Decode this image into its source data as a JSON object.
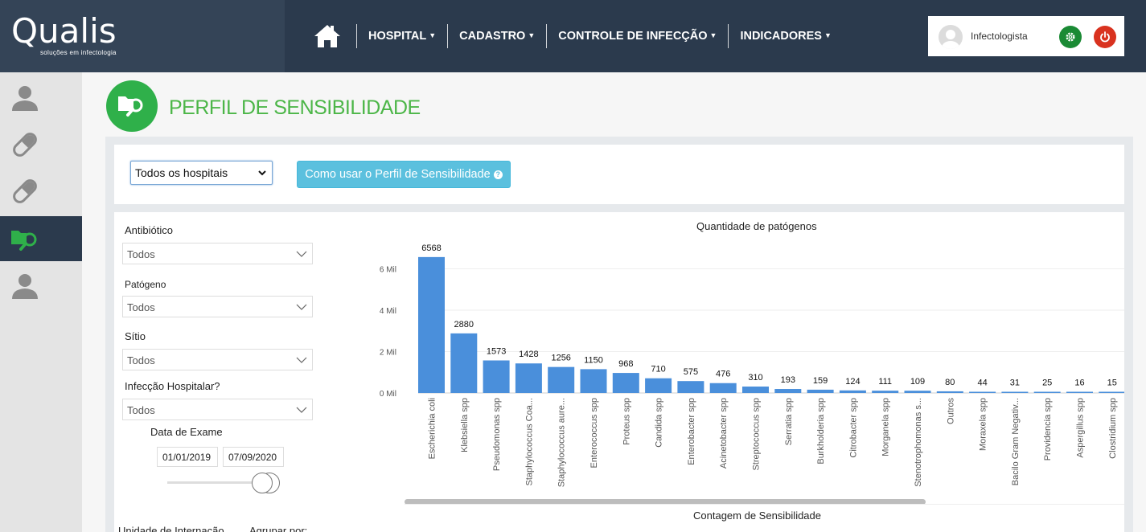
{
  "brand": {
    "name": "Qualis",
    "tagline": "soluções em infectologia"
  },
  "nav": {
    "items": [
      {
        "label": "HOSPITAL"
      },
      {
        "label": "CADASTRO"
      },
      {
        "label": "CONTROLE DE INFECÇÃO"
      },
      {
        "label": "INDICADORES"
      }
    ]
  },
  "user": {
    "name": "Infectologista"
  },
  "page": {
    "title": "PERFIL DE SENSIBILIDADE"
  },
  "toolbar": {
    "hospital_select": "Todos os hospitais",
    "help_button": "Como usar o Perfil de Sensibilidade"
  },
  "filters": {
    "antibiotico": {
      "label": "Antibiótico",
      "value": "Todos"
    },
    "patogeno": {
      "label": "Patógeno",
      "value": "Todos"
    },
    "sitio": {
      "label": "Sítio",
      "value": "Todos"
    },
    "infeccao": {
      "label": "Infecção Hospitalar?",
      "value": "Todos"
    },
    "data_exame": {
      "label": "Data de Exame",
      "start": "01/01/2019",
      "end": "07/09/2020"
    },
    "unidade_label": "Unidade de Internação",
    "agrupar_label": "Agrupar por:"
  },
  "colors": {
    "bar": "#4a8fdb",
    "accent": "#4cb648",
    "navbar": "#2b3a4d"
  },
  "chart_data": {
    "type": "bar",
    "title": "Quantidade de patógenos",
    "categories": [
      "Escherichia coli",
      "Klebsiella spp",
      "Pseudomonas spp",
      "Staphylococcus Coa...",
      "Staphylococcus aure...",
      "Enterococcus spp",
      "Proteus spp",
      "Candida spp",
      "Enterobacter spp",
      "Acinetobacter spp",
      "Streptococcus spp",
      "Serratia spp",
      "Burkholderia spp",
      "Citrobacter spp",
      "Morganela spp",
      "Stenotrophomonas s...",
      "Outros",
      "Moraxela spp",
      "Bacilo Gram Negativ...",
      "Providencia spp",
      "Aspergillus spp",
      "Clostridium spp"
    ],
    "values": [
      6568,
      2880,
      1573,
      1428,
      1256,
      1150,
      968,
      710,
      575,
      476,
      310,
      193,
      159,
      124,
      111,
      109,
      80,
      44,
      31,
      25,
      16,
      15
    ],
    "y_ticks": [
      "0 Mil",
      "2 Mil",
      "4 Mil",
      "6 Mil"
    ],
    "ylim": [
      0,
      7000
    ],
    "grid": true
  },
  "chart2": {
    "title": "Contagem de Sensibilidade"
  }
}
